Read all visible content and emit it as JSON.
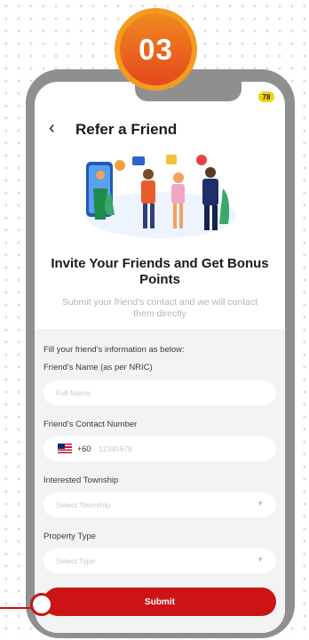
{
  "step": {
    "number": "03"
  },
  "status": {
    "badge": "78"
  },
  "header": {
    "title": "Refer a Friend",
    "back_icon": "chevron-left-icon"
  },
  "hero": {
    "headline": "Invite Your Friends and Get Bonus Points",
    "subtitle": "Submit your friend's contact and we will contact them directly"
  },
  "form": {
    "intro": "Fill your friend's information as below:",
    "name_label": "Friend's Name (as per NRIC)",
    "name_placeholder": "Full Name",
    "contact_label": "Friend's Contact Number",
    "country_code": "+60",
    "contact_placeholder": "12345678",
    "township_label": "Interested Township",
    "township_placeholder": "Select Township",
    "property_label": "Property Type",
    "property_placeholder": "Select Type",
    "submit_label": "Submit"
  },
  "colors": {
    "accent": "#cc1414",
    "step_orange": "#f08a1f",
    "frame": "#8f8f8f"
  }
}
